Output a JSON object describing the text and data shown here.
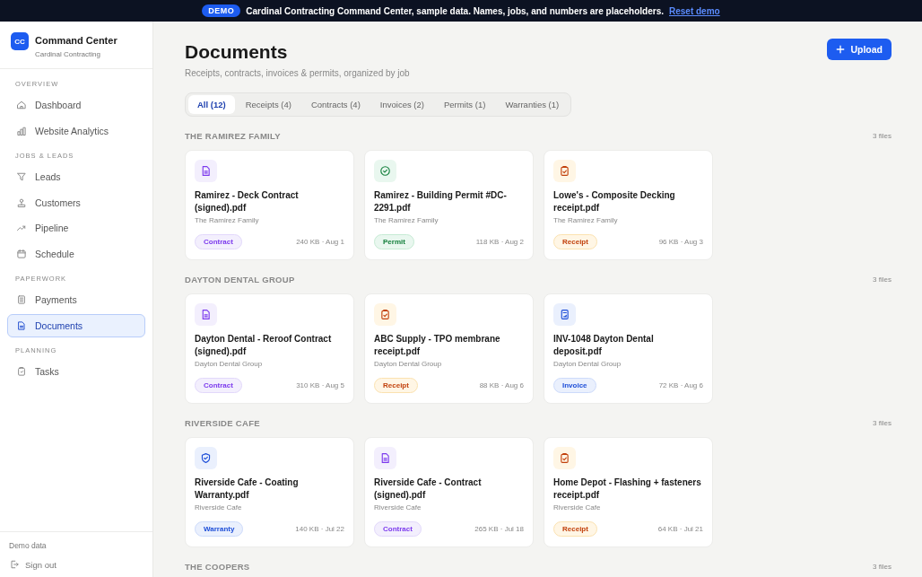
{
  "banner": {
    "badge": "DEMO",
    "message": "Cardinal Contracting Command Center, sample data. Names, jobs, and numbers are placeholders.",
    "link": "Reset demo"
  },
  "brand": {
    "logo": "CC",
    "name": "Command Center",
    "company": "Cardinal Contracting"
  },
  "sidebar": {
    "sections": [
      {
        "heading": "OVERVIEW",
        "items": [
          {
            "label": "Dashboard",
            "kind": "home",
            "selected": false
          },
          {
            "label": "Website Analytics",
            "kind": "chart",
            "selected": false
          }
        ]
      },
      {
        "heading": "JOBS & LEADS",
        "items": [
          {
            "label": "Leads",
            "kind": "filter",
            "selected": false
          },
          {
            "label": "Customers",
            "kind": "people",
            "selected": false
          },
          {
            "label": "Pipeline",
            "kind": "trend",
            "selected": false
          },
          {
            "label": "Schedule",
            "kind": "calendar",
            "selected": false
          }
        ]
      },
      {
        "heading": "PAPERWORK",
        "items": [
          {
            "label": "Payments",
            "kind": "receipt",
            "selected": false
          },
          {
            "label": "Documents",
            "kind": "doc",
            "selected": true
          }
        ]
      },
      {
        "heading": "PLANNING",
        "items": [
          {
            "label": "Tasks",
            "kind": "clipboard",
            "selected": false
          }
        ]
      }
    ],
    "footer_label": "Demo data",
    "sign_out": "Sign out"
  },
  "page": {
    "title": "Documents",
    "subtitle": "Receipts, contracts, invoices & permits, organized by job",
    "upload_button": "Upload"
  },
  "tabs": [
    {
      "label": "All (12)",
      "selected": true
    },
    {
      "label": "Receipts (4)",
      "selected": false
    },
    {
      "label": "Contracts (4)",
      "selected": false
    },
    {
      "label": "Invoices (2)",
      "selected": false
    },
    {
      "label": "Permits (1)",
      "selected": false
    },
    {
      "label": "Warranties (1)",
      "selected": false
    }
  ],
  "groups": [
    {
      "name": "THE RAMIREZ FAMILY",
      "count": "3 files",
      "documents": [
        {
          "kind": "contract",
          "title": "Ramirez - Deck Contract (signed).pdf",
          "client": "The Ramirez Family",
          "tag": "Contract",
          "meta": "240 KB · Aug 1"
        },
        {
          "kind": "permit",
          "title": "Ramirez - Building Permit #DC-2291.pdf",
          "client": "The Ramirez Family",
          "tag": "Permit",
          "meta": "118 KB · Aug 2"
        },
        {
          "kind": "receipt",
          "title": "Lowe's - Composite Decking receipt.pdf",
          "client": "The Ramirez Family",
          "tag": "Receipt",
          "meta": "96 KB · Aug 3"
        }
      ]
    },
    {
      "name": "DAYTON DENTAL GROUP",
      "count": "3 files",
      "documents": [
        {
          "kind": "contract",
          "title": "Dayton Dental - Reroof Contract (signed).pdf",
          "client": "Dayton Dental Group",
          "tag": "Contract",
          "meta": "310 KB · Aug 5"
        },
        {
          "kind": "receipt",
          "title": "ABC Supply - TPO membrane receipt.pdf",
          "client": "Dayton Dental Group",
          "tag": "Receipt",
          "meta": "88 KB · Aug 6"
        },
        {
          "kind": "invoice",
          "title": "INV-1048 Dayton Dental deposit.pdf",
          "client": "Dayton Dental Group",
          "tag": "Invoice",
          "meta": "72 KB · Aug 6"
        }
      ]
    },
    {
      "name": "RIVERSIDE CAFE",
      "count": "3 files",
      "documents": [
        {
          "kind": "warranty",
          "title": "Riverside Cafe - Coating Warranty.pdf",
          "client": "Riverside Cafe",
          "tag": "Warranty",
          "meta": "140 KB · Jul 22"
        },
        {
          "kind": "contract",
          "title": "Riverside Cafe - Contract (signed).pdf",
          "client": "Riverside Cafe",
          "tag": "Contract",
          "meta": "265 KB · Jul 18"
        },
        {
          "kind": "receipt",
          "title": "Home Depot - Flashing + fasteners receipt.pdf",
          "client": "Riverside Cafe",
          "tag": "Receipt",
          "meta": "64 KB · Jul 21"
        }
      ]
    },
    {
      "name": "THE COOPERS",
      "count": "3 files"
    }
  ]
}
